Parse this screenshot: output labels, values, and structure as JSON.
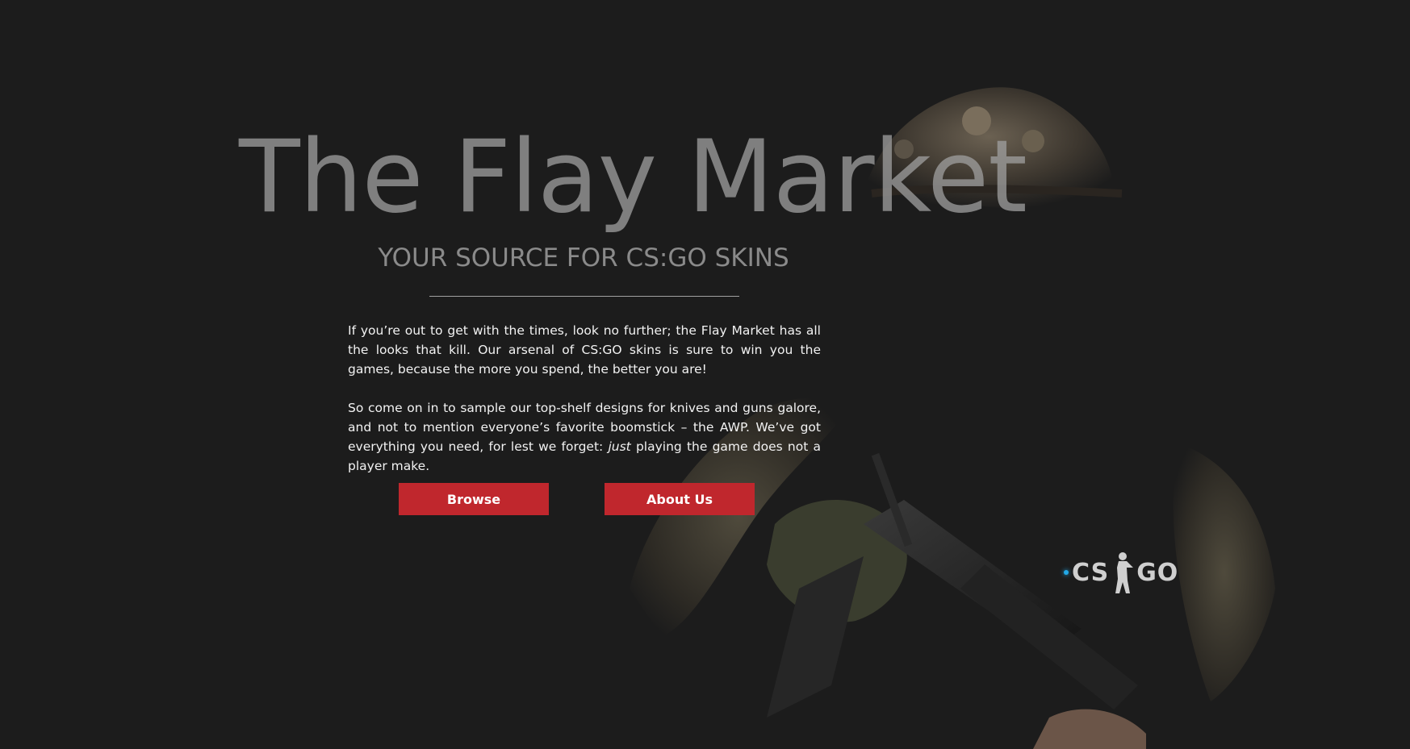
{
  "hero": {
    "title": "The Flay Market",
    "subtitle": "YOUR SOURCE FOR CS:GO SKINS"
  },
  "intro": {
    "paragraph1": "If you’re out to get with the times, look no further; the Flay Market has all the looks that kill. Our arsenal of CS:GO skins is sure to win you the games, because the more you spend, the better you are!",
    "paragraph2_before": "So come on in to sample our top-shelf designs for knives and guns galore, and not to mention everyone’s favorite boomstick – the AWP. We’ve got everything you need, for lest we forget: ",
    "paragraph2_emphasis": "just",
    "paragraph2_after": " playing the game does not a player make."
  },
  "buttons": {
    "browse_label": "Browse",
    "about_label": "About Us"
  },
  "logo": {
    "left_text": "CS",
    "right_text": "GO",
    "icon": "soldier-silhouette-icon"
  },
  "colors": {
    "background": "#1c1c1c",
    "accent": "#c0272d",
    "logo_glow": "#22a9e8"
  }
}
